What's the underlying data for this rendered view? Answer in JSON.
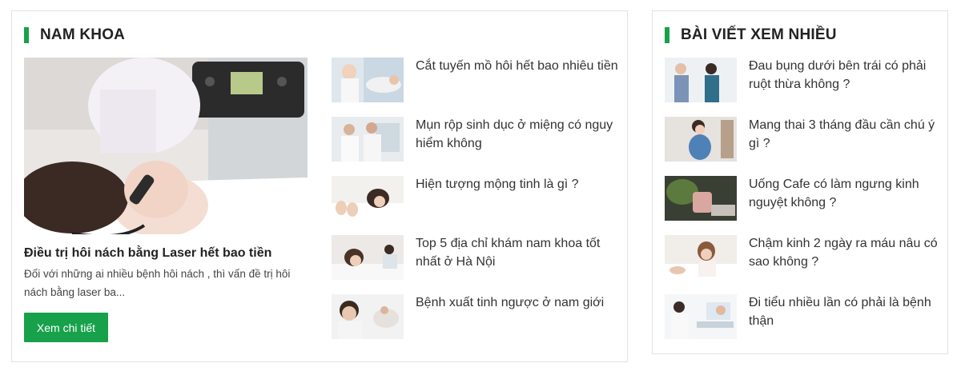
{
  "left": {
    "heading": "NAM KHOA",
    "featured": {
      "title": "Điều trị hôi nách bằng Laser hết bao tiền",
      "excerpt": "Đối với những ai nhiều bệnh hôi nách , thì vấn đề trị hôi nách bằng laser ba...",
      "button_label": "Xem chi tiết"
    },
    "items": [
      {
        "title": "Cắt tuyến mồ hôi hết bao nhiêu tiền"
      },
      {
        "title": "Mụn rộp sinh dục ở miệng có nguy hiểm không"
      },
      {
        "title": "Hiện tượng mộng tinh là gì ?"
      },
      {
        "title": "Top 5 địa chỉ khám nam khoa tốt nhất ở Hà Nội"
      },
      {
        "title": "Bệnh xuất tinh ngược ở nam giới"
      }
    ]
  },
  "right": {
    "heading": "BÀI VIẾT XEM NHIỀU",
    "items": [
      {
        "title": "Đau bụng dưới bên trái có phải ruột thừa không ?"
      },
      {
        "title": "Mang thai 3 tháng đầu cần chú ý gì ?"
      },
      {
        "title": "Uống Cafe có làm ngưng kinh nguyệt không ?"
      },
      {
        "title": "Chậm kinh 2 ngày ra máu nâu có sao không ?"
      },
      {
        "title": "Đi tiểu nhiều lần có phải là bệnh thận"
      }
    ]
  },
  "colors": {
    "accent": "#17a14b",
    "border": "#e2e2e2"
  }
}
